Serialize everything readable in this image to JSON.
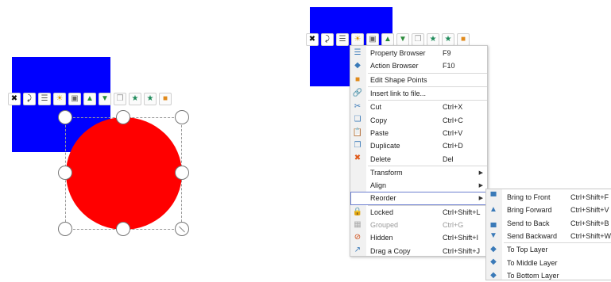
{
  "colors": {
    "blue": "#0000ff",
    "red": "#ff0000",
    "highlight": "#6c7fd0"
  },
  "toolbar_icons": [
    {
      "name": "crossed-arrows-icon",
      "glyph": "✖"
    },
    {
      "name": "curved-arrow-icon",
      "glyph": "⤸"
    },
    {
      "name": "property-sheet-icon",
      "glyph": "☰"
    },
    {
      "name": "sun-icon",
      "glyph": "☀"
    },
    {
      "name": "stack-icon",
      "glyph": "▣"
    },
    {
      "name": "bring-forward-icon",
      "glyph": "▲"
    },
    {
      "name": "send-backward-icon",
      "glyph": "▼"
    },
    {
      "name": "duplicate-icon",
      "glyph": "❐"
    },
    {
      "name": "star-up-icon",
      "glyph": "★"
    },
    {
      "name": "star-down-icon",
      "glyph": "★"
    },
    {
      "name": "square-icon",
      "glyph": "■"
    }
  ],
  "context_menu": [
    {
      "label": "Property Browser",
      "shortcut": "F9",
      "icon": "property-browser-icon",
      "glyph": "☰"
    },
    {
      "label": "Action Browser",
      "shortcut": "F10",
      "icon": "action-browser-icon",
      "glyph": "◆"
    },
    {
      "sep": true
    },
    {
      "label": "Edit Shape Points",
      "shortcut": "",
      "icon": "edit-points-icon",
      "glyph": "■"
    },
    {
      "sep": true
    },
    {
      "label": "Insert link to file...",
      "shortcut": "",
      "icon": "link-icon",
      "glyph": "🔗"
    },
    {
      "sep": true
    },
    {
      "label": "Cut",
      "shortcut": "Ctrl+X",
      "icon": "cut-icon",
      "glyph": "✂"
    },
    {
      "label": "Copy",
      "shortcut": "Ctrl+C",
      "icon": "copy-icon",
      "glyph": "❏"
    },
    {
      "label": "Paste",
      "shortcut": "Ctrl+V",
      "icon": "paste-icon",
      "glyph": "📋"
    },
    {
      "label": "Duplicate",
      "shortcut": "Ctrl+D",
      "icon": "duplicate-icon",
      "glyph": "❐"
    },
    {
      "label": "Delete",
      "shortcut": "Del",
      "icon": "delete-icon",
      "glyph": "✖"
    },
    {
      "sep": true
    },
    {
      "label": "Transform",
      "shortcut": "",
      "submenu": true
    },
    {
      "label": "Align",
      "shortcut": "",
      "submenu": true
    },
    {
      "label": "Reorder",
      "shortcut": "",
      "submenu": true,
      "highlight": true
    },
    {
      "sep": true
    },
    {
      "label": "Locked",
      "shortcut": "Ctrl+Shift+L",
      "icon": "lock-icon",
      "glyph": "🔒"
    },
    {
      "label": "Grouped",
      "shortcut": "Ctrl+G",
      "icon": "group-icon",
      "glyph": "▦",
      "disabled": true
    },
    {
      "label": "Hidden",
      "shortcut": "Ctrl+Shift+I",
      "icon": "hidden-icon",
      "glyph": "⊘"
    },
    {
      "label": "Drag a Copy",
      "shortcut": "Ctrl+Shift+J",
      "icon": "drag-copy-icon",
      "glyph": "↗"
    }
  ],
  "reorder_submenu": [
    {
      "label": "Bring to Front",
      "shortcut": "Ctrl+Shift+F",
      "icon": "bring-to-front-icon",
      "glyph": "▀"
    },
    {
      "label": "Bring Forward",
      "shortcut": "Ctrl+Shift+V",
      "icon": "bring-forward-icon",
      "glyph": "▲"
    },
    {
      "label": "Send to Back",
      "shortcut": "Ctrl+Shift+B",
      "icon": "send-to-back-icon",
      "glyph": "▄"
    },
    {
      "label": "Send Backward",
      "shortcut": "Ctrl+Shift+W",
      "icon": "send-backward-icon",
      "glyph": "▼"
    },
    {
      "sep": true
    },
    {
      "label": "To Top Layer",
      "shortcut": "",
      "icon": "top-layer-icon",
      "glyph": "◆"
    },
    {
      "label": "To Middle Layer",
      "shortcut": "",
      "icon": "middle-layer-icon",
      "glyph": "◆"
    },
    {
      "label": "To Bottom Layer",
      "shortcut": "",
      "icon": "bottom-layer-icon",
      "glyph": "◆"
    }
  ]
}
